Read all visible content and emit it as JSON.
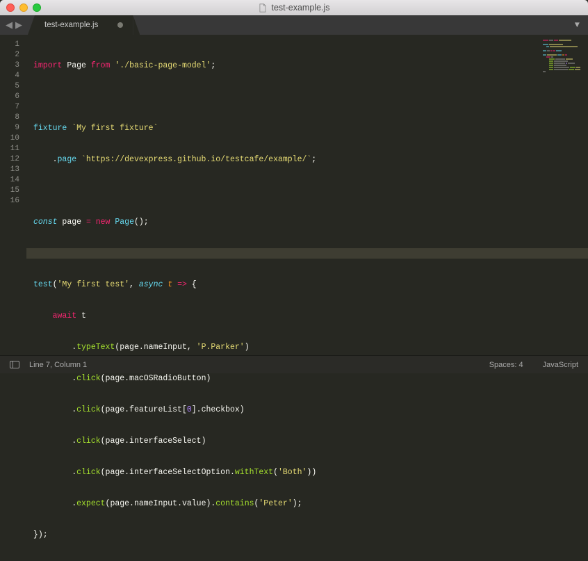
{
  "window": {
    "title": "test-example.js"
  },
  "tab": {
    "label": "test-example.js"
  },
  "gutter": [
    "1",
    "2",
    "3",
    "4",
    "5",
    "6",
    "7",
    "8",
    "9",
    "10",
    "11",
    "12",
    "13",
    "14",
    "15",
    "16"
  ],
  "code": {
    "l1": {
      "import": "import",
      "page": "Page",
      "from": "from",
      "path": "'./basic-page-model'",
      "semi": ";"
    },
    "l3": {
      "fixture": "fixture",
      "tpl": "`My first fixture`"
    },
    "l4": {
      "dot": ".",
      "page": "page",
      "sp": " ",
      "url": "`https://devexpress.github.io/testcafe/example/`",
      "semi": ";"
    },
    "l6": {
      "const": "const",
      "page": "page",
      "eq": "=",
      "new": "new",
      "cls": "Page",
      "call": "();"
    },
    "l8": {
      "test": "test",
      "open": "(",
      "name": "'My first test'",
      "comma": ", ",
      "async": "async",
      "sp": " ",
      "t": "t",
      "arrow": " => ",
      "brace": "{"
    },
    "l9": {
      "await": "await",
      "t": " t"
    },
    "l10": {
      "dot": ".",
      "fn": "typeText",
      "args_a": "(page.nameInput, ",
      "str": "'P.Parker'",
      "args_b": ")"
    },
    "l11": {
      "dot": ".",
      "fn": "click",
      "args": "(page.macOSRadioButton)"
    },
    "l12": {
      "dot": ".",
      "fn": "click",
      "args_a": "(page.featureList[",
      "num": "0",
      "args_b": "].checkbox)"
    },
    "l13": {
      "dot": ".",
      "fn": "click",
      "args": "(page.interfaceSelect)"
    },
    "l14": {
      "dot": ".",
      "fn": "click",
      "args_a": "(page.interfaceSelectOption.",
      "with": "withText",
      "args_b": "(",
      "str": "'Both'",
      "args_c": "))"
    },
    "l15": {
      "dot": ".",
      "fn": "expect",
      "args_a": "(page.nameInput.value).",
      "cont": "contains",
      "args_b": "(",
      "str": "'Peter'",
      "args_c": ");"
    },
    "l16": {
      "close": "});"
    }
  },
  "status": {
    "pos": "Line 7, Column 1",
    "spaces": "Spaces: 4",
    "lang": "JavaScript"
  }
}
